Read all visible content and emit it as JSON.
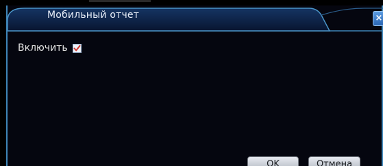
{
  "dialog": {
    "title": "Мобильный отчет",
    "close_symbol": "×",
    "close_icon": "close-icon"
  },
  "settings": {
    "enable_label": "Включить",
    "enable_checked": true
  },
  "buttons": {
    "ok_label": "OK",
    "cancel_label": "Отмена"
  },
  "colors": {
    "title_bar": "#0b1f3f",
    "frame_border": "#3f86b8",
    "background": "#05060f",
    "checkmark": "#d0342c"
  }
}
